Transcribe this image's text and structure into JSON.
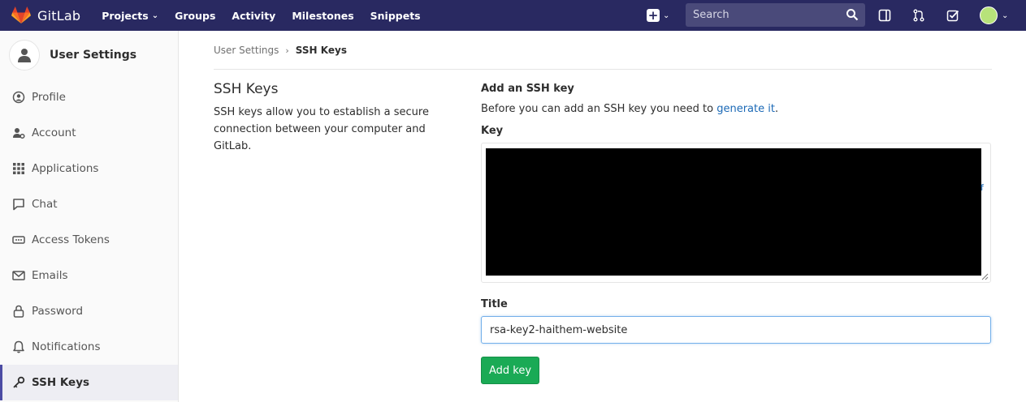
{
  "colors": {
    "nav_bg": "#292961",
    "sidebar_bg": "#fafafa",
    "accent": "#4b4ba3",
    "link": "#1b69b6",
    "primary_button": "#1aaa55"
  },
  "topnav": {
    "brand": "GitLab",
    "links": [
      {
        "label": "Projects",
        "dropdown": true
      },
      {
        "label": "Groups"
      },
      {
        "label": "Activity"
      },
      {
        "label": "Milestones"
      },
      {
        "label": "Snippets"
      }
    ],
    "search": {
      "placeholder": "Search"
    },
    "icons": [
      "plus-square-icon",
      "sidebar-panel-icon",
      "merge-request-icon",
      "todo-check-icon",
      "user-avatar"
    ]
  },
  "sidebar": {
    "title": "User Settings",
    "items": [
      {
        "label": "Profile",
        "icon": "profile-icon"
      },
      {
        "label": "Account",
        "icon": "account-icon"
      },
      {
        "label": "Applications",
        "icon": "applications-grid-icon"
      },
      {
        "label": "Chat",
        "icon": "chat-icon"
      },
      {
        "label": "Access Tokens",
        "icon": "access-tokens-icon"
      },
      {
        "label": "Emails",
        "icon": "envelope-icon"
      },
      {
        "label": "Password",
        "icon": "lock-icon"
      },
      {
        "label": "Notifications",
        "icon": "bell-icon"
      },
      {
        "label": "SSH Keys",
        "icon": "key-icon",
        "active": true
      }
    ]
  },
  "breadcrumb": {
    "parent": "User Settings",
    "current": "SSH Keys"
  },
  "section": {
    "title": "SSH Keys",
    "description": "SSH keys allow you to establish a secure connection between your computer and GitLab."
  },
  "form": {
    "heading": "Add an SSH key",
    "intro_before": "Before you can add an SSH key you need to ",
    "intro_link": "generate it",
    "intro_after": ".",
    "key_label": "Key",
    "key_visible_fragment": "f",
    "title_label": "Title",
    "title_value": "rsa-key2-haithem-website",
    "submit_label": "Add key"
  }
}
